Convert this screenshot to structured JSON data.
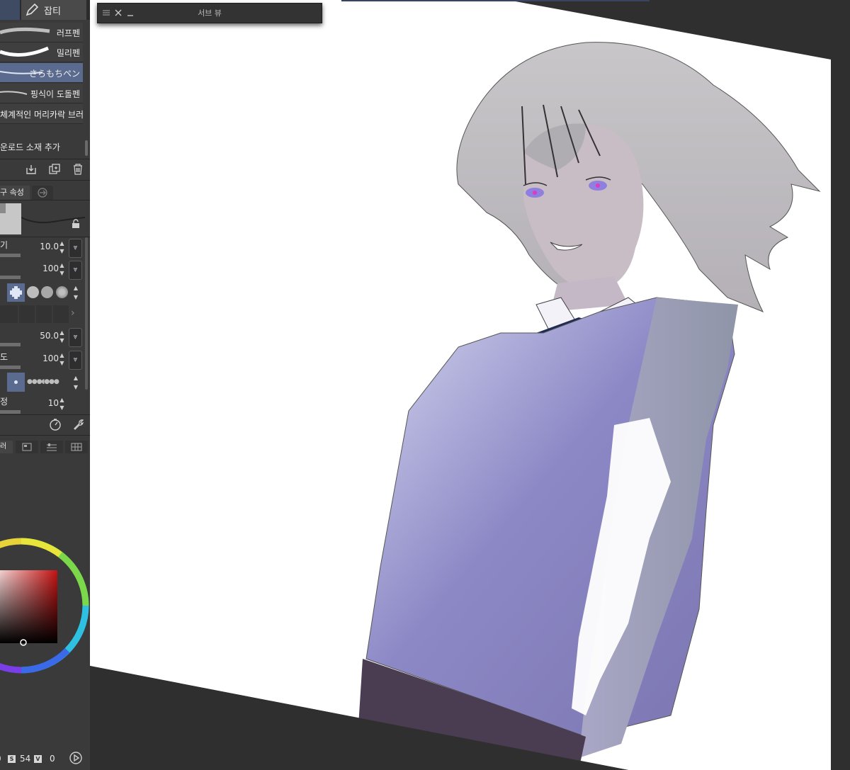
{
  "top_tabs": {
    "active_label": "잡티"
  },
  "brushes": [
    {
      "label": "러프펜",
      "selected": false
    },
    {
      "label": "밀리펜",
      "selected": false
    },
    {
      "label": "さらもちペン",
      "selected": true
    },
    {
      "label": "핑식이 도돌펜",
      "selected": false
    },
    {
      "label": "체계적인 머리카락 브러",
      "selected": false
    }
  ],
  "add_material_label": "운로드 소재 추가",
  "tool_property_tab": "구 속성",
  "properties": [
    {
      "label": "기",
      "value": "10.0"
    },
    {
      "label": "",
      "value": "100"
    },
    {
      "label": "",
      "value": "50.0"
    },
    {
      "label": "도",
      "value": "100"
    },
    {
      "label": "정",
      "value": "10"
    }
  ],
  "palette_tab_label": "러",
  "status": {
    "s_label": "S",
    "s_value": "54",
    "v_label": "V",
    "v_value": "0"
  },
  "subview": {
    "title": "서브 뷰"
  },
  "colors": {
    "accent": "#5b6b8f",
    "panel": "#3a3a3a",
    "canvas_bg": "#2f2f2f",
    "current_color": "#9b1f1f"
  },
  "icons": [
    "pen-icon",
    "import-icon",
    "duplicate-icon",
    "trash-icon",
    "lock-icon",
    "clock-icon",
    "wrench-icon",
    "play-icon",
    "close-icon",
    "minimize-icon",
    "menu-icon"
  ]
}
